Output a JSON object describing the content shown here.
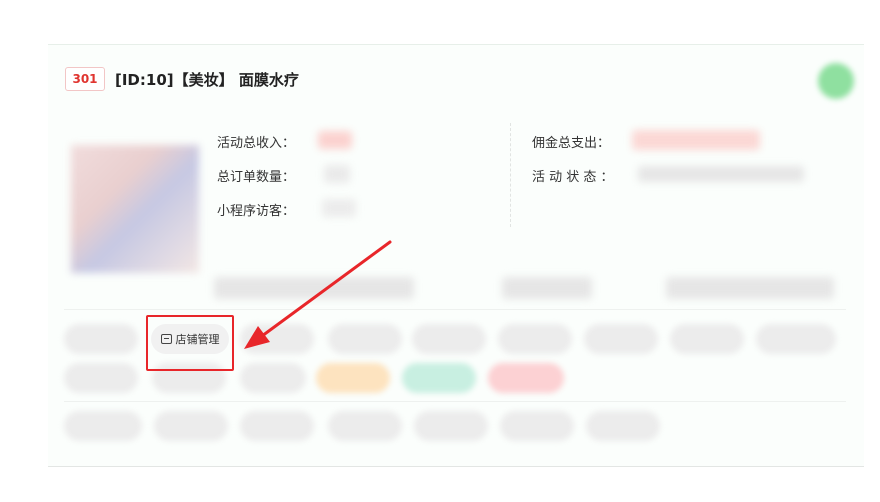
{
  "card": {
    "id_badge": "301",
    "title": "[ID:10]【美妆】 面膜水疗"
  },
  "stats": {
    "total_income_label": "活动总收入：",
    "total_orders_label": "总订单数量：",
    "miniprogram_visitors_label": "小程序访客：",
    "total_commission_label": "佣金总支出：",
    "activity_status_label": "活 动 状 态 ："
  },
  "actions": {
    "shop_manage_label": "店铺管理"
  },
  "colors": {
    "accent_red": "#e8262a",
    "badge_red": "#e0342f",
    "status_green": "#8fe0a0"
  },
  "icons": {
    "shop_manage": "storefront-icon",
    "annotation": "red-arrow"
  }
}
